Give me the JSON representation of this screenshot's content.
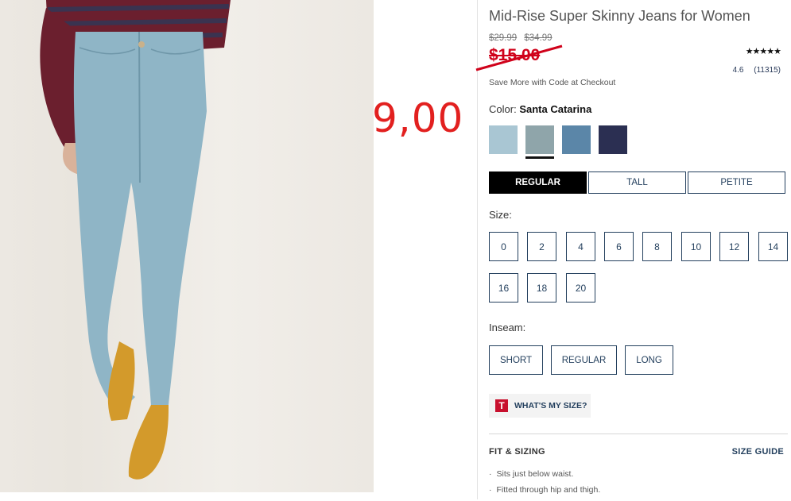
{
  "product": {
    "title": "Mid-Rise Super Skinny Jeans for Women",
    "original_prices": [
      "$29.99",
      "$34.99"
    ],
    "sale_price": "$15.00",
    "promo_text": "Save More with Code at Checkout",
    "rating": {
      "stars_glyph": "★★★★★",
      "value": "4.6",
      "count": "(11315)"
    }
  },
  "annotation": "9,00",
  "color": {
    "label": "Color:",
    "selected": "Santa Catarina",
    "swatches": [
      {
        "color": "#a9c6d3",
        "selected": false
      },
      {
        "color": "#8fa5aa",
        "selected": true
      },
      {
        "color": "#5b86a8",
        "selected": false
      },
      {
        "color": "#2b2f52",
        "selected": false
      }
    ]
  },
  "fit_tabs": [
    {
      "label": "REGULAR",
      "active": true
    },
    {
      "label": "TALL",
      "active": false
    },
    {
      "label": "PETITE",
      "active": false
    }
  ],
  "size": {
    "label": "Size:",
    "options": [
      "0",
      "2",
      "4",
      "6",
      "8",
      "10",
      "12",
      "14",
      "16",
      "18",
      "20"
    ]
  },
  "inseam": {
    "label": "Inseam:",
    "options": [
      "SHORT",
      "REGULAR",
      "LONG"
    ]
  },
  "whats_my_size": {
    "logo": "T",
    "label": "WHAT'S MY SIZE?"
  },
  "fit_sizing": {
    "heading": "FIT & SIZING",
    "size_guide": "SIZE GUIDE",
    "bullets": [
      "Sits just below waist.",
      "Fitted through hip and thigh."
    ]
  },
  "colors": {
    "sale_red": "#d0021b",
    "navy_text": "#24405e",
    "annotation_red": "#e2201f"
  }
}
